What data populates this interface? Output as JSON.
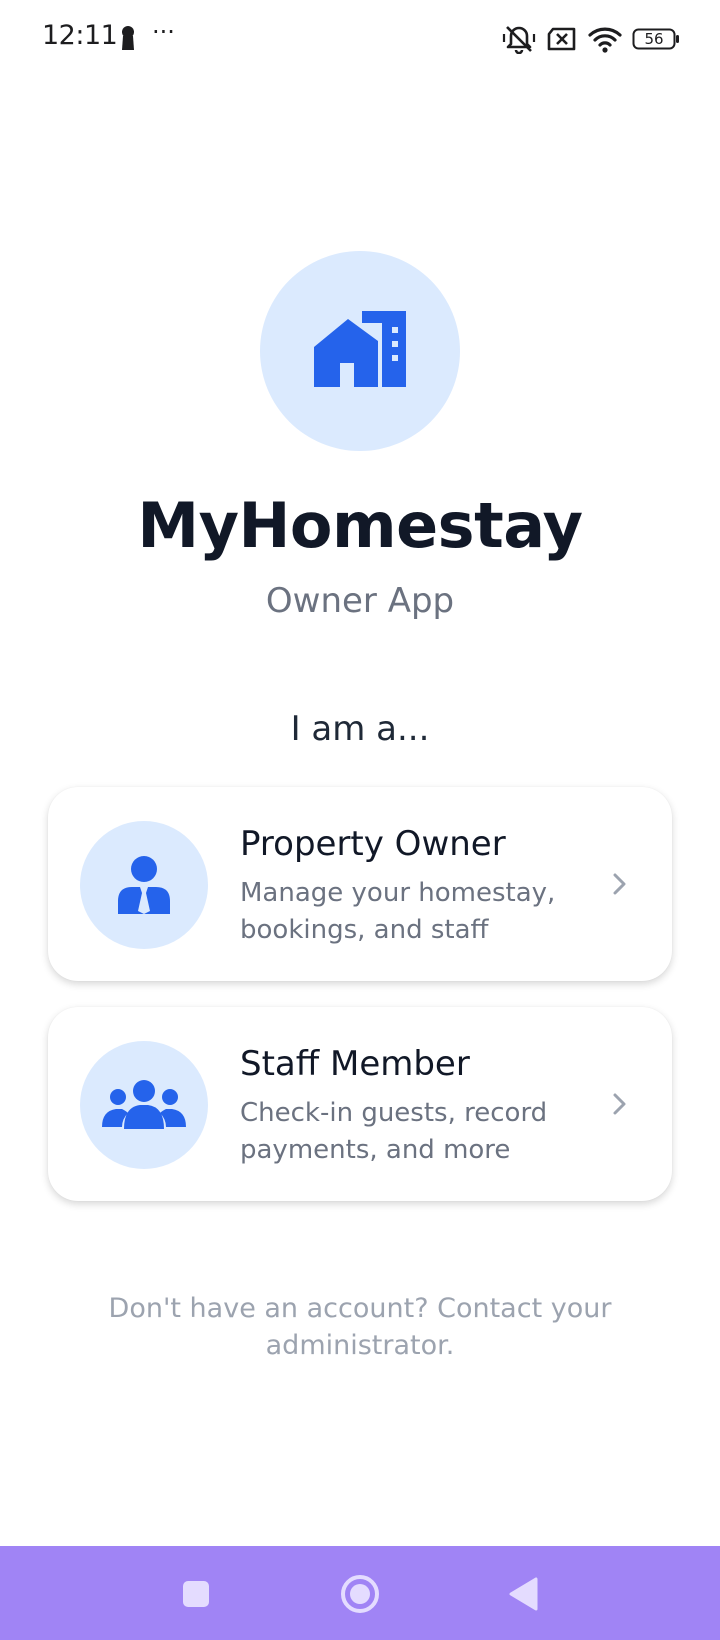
{
  "status_bar": {
    "time": "12:11",
    "overflow": "···",
    "battery_level": "56",
    "icons": [
      "keyhole-icon",
      "vibrate-off-icon",
      "sim-error-icon",
      "wifi-icon",
      "battery-icon"
    ]
  },
  "header": {
    "app_name": "MyHomestay",
    "subtitle": "Owner App",
    "logo_icon": "building-icon",
    "accent_color": "#2563eb",
    "accent_light": "#dbeafe"
  },
  "role_prompt": "I am a...",
  "roles": [
    {
      "title": "Property Owner",
      "description": "Manage your homestay, bookings, and staff",
      "icon": "user-tie-icon"
    },
    {
      "title": "Staff Member",
      "description": "Check-in guests, record payments, and more",
      "icon": "users-group-icon"
    }
  ],
  "footer_note": "Don't have an account? Contact your administrator.",
  "nav_bar": {
    "buttons": [
      "recents-button",
      "home-button",
      "back-button"
    ],
    "color": "#a084f5"
  }
}
